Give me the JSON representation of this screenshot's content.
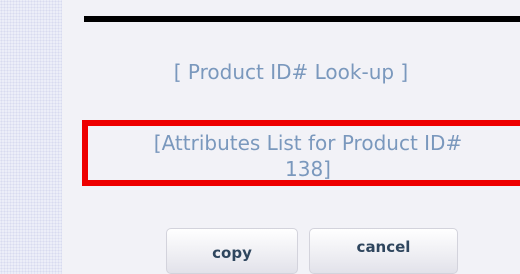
{
  "lookup_link": "[ Product ID# Look-up ]",
  "attributes_link": {
    "line1": "[Attributes List for Product ID#",
    "line2": "138]"
  },
  "buttons": {
    "copy": "copy",
    "cancel": "cancel"
  },
  "colors": {
    "link": "#7a98bd",
    "highlight_border": "#ee0000",
    "rule": "#000000"
  }
}
